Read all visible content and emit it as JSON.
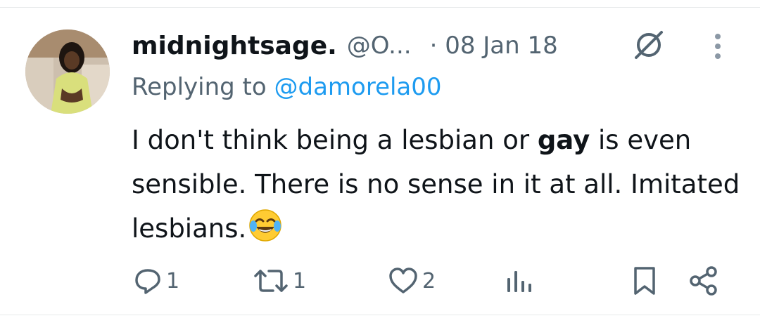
{
  "tweet": {
    "display_name": "midnightsage.",
    "handle": "@O...",
    "timestamp": "· 08 Jan 18",
    "reply_prefix": "Replying to ",
    "reply_handle": "@damorela00",
    "text_part1": "I don't think being a lesbian or ",
    "text_bold": "gay",
    "text_part2": " is even sensible. There is no sense in it at all. Imitated lesbians."
  },
  "actions": {
    "reply_count": "1",
    "retweet_count": "1",
    "like_count": "2"
  },
  "icons": [
    "edit-icon",
    "more-icon",
    "reply-icon",
    "retweet-icon",
    "like-icon",
    "views-icon",
    "bookmark-icon",
    "share-icon",
    "laughing-emoji-icon"
  ],
  "colors": {
    "text": "#0f1419",
    "secondary": "#536471",
    "link": "#1d9bf0",
    "divider": "#e7e9ea"
  }
}
